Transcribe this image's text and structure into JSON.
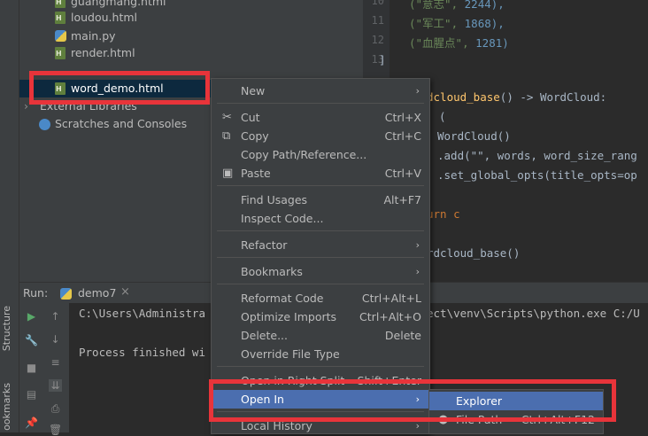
{
  "project_tree": {
    "items": [
      {
        "name": "guangmang.html",
        "type": "html"
      },
      {
        "name": "loudou.html",
        "type": "html"
      },
      {
        "name": "main.py",
        "type": "python"
      },
      {
        "name": "render.html",
        "type": "html"
      },
      {
        "name": "word_demo.html",
        "type": "html",
        "selected": true
      }
    ],
    "external_libraries": "External Libraries",
    "scratches": "Scratches and Consoles"
  },
  "editor": {
    "line_numbers": [
      "10",
      "11",
      "12",
      "13"
    ],
    "lines": [
      {
        "str": "(\"意志\",",
        "num": "2244),"
      },
      {
        "str": "(\"军工\",",
        "num": "1868),"
      },
      {
        "str": "(\"血腥点\",",
        "num": "1281)"
      },
      {
        "str": "]"
      }
    ],
    "func_def": {
      "name": "dcloud_base",
      "rest": "() -> WordCloud:"
    },
    "code_lines": [
      "(",
      "WordCloud()",
      ".add(\"\", words, word_size_rang",
      ".set_global_opts(title_opts=op"
    ],
    "return_line": "urn c",
    "call_line": "rdcloud_base()"
  },
  "run_panel": {
    "label": "Run:",
    "tab": "demo7",
    "console_lines": [
      "C:\\Users\\Administra",
      "Process finished wi"
    ],
    "console_suffix": "ect\\venv\\Scripts\\python.exe C:/U"
  },
  "side_labels": {
    "structure": "Structure",
    "bookmarks": "ookmarks"
  },
  "context_menu": {
    "items": [
      {
        "label": "New",
        "submenu": true
      },
      {
        "label": "Cut",
        "shortcut": "Ctrl+X",
        "icon": "scissors-icon"
      },
      {
        "label": "Copy",
        "shortcut": "Ctrl+C",
        "icon": "copy-icon"
      },
      {
        "label": "Copy Path/Reference..."
      },
      {
        "label": "Paste",
        "shortcut": "Ctrl+V",
        "icon": "paste-icon"
      },
      {
        "label": "Find Usages",
        "shortcut": "Alt+F7"
      },
      {
        "label": "Inspect Code..."
      },
      {
        "label": "Refactor",
        "submenu": true
      },
      {
        "label": "Bookmarks",
        "submenu": true
      },
      {
        "label": "Reformat Code",
        "shortcut": "Ctrl+Alt+L"
      },
      {
        "label": "Optimize Imports",
        "shortcut": "Ctrl+Alt+O"
      },
      {
        "label": "Delete...",
        "shortcut": "Delete"
      },
      {
        "label": "Override File Type"
      },
      {
        "label": "Open in Right Split",
        "shortcut": "Shift+Enter"
      },
      {
        "label": "Open In",
        "submenu": true,
        "highlighted": true
      },
      {
        "label": "Local History",
        "submenu": true
      }
    ]
  },
  "submenu": {
    "items": [
      {
        "label": "Explorer",
        "highlighted": true
      },
      {
        "label": "File Path",
        "shortcut": "Ctrl+Alt+F12"
      }
    ]
  },
  "colors": {
    "highlight": "#4b6eaf",
    "annotation_red": "#e8343a",
    "background": "#2b2b2b"
  }
}
